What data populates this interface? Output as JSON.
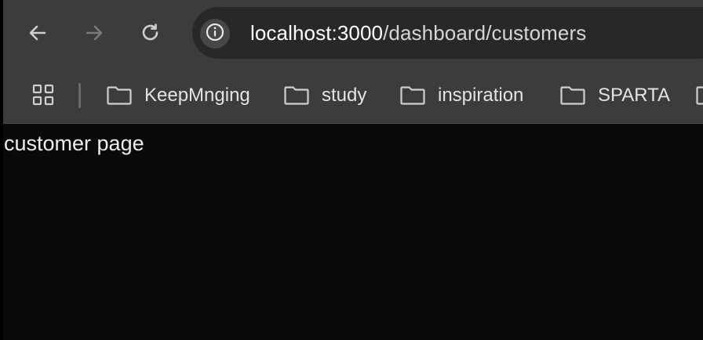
{
  "browser": {
    "nav": {
      "back_icon": "arrow-left-icon",
      "forward_icon": "arrow-right-icon",
      "reload_icon": "reload-icon",
      "forward_enabled": false
    },
    "omnibox": {
      "site_info_icon": "info-icon",
      "url_host": "localhost:3000",
      "url_path": "/dashboard/customers"
    },
    "bookmarks": {
      "apps_icon": "apps-grid-icon",
      "items": [
        {
          "label": "KeepMnging",
          "icon": "folder-icon"
        },
        {
          "label": "study",
          "icon": "folder-icon"
        },
        {
          "label": "inspiration",
          "icon": "folder-icon"
        },
        {
          "label": "SPARTA",
          "icon": "folder-icon"
        },
        {
          "label": "",
          "icon": "folder-icon"
        }
      ]
    }
  },
  "page": {
    "text": "customer page"
  },
  "colors": {
    "toolbar_bg": "#3c3c3c",
    "omnibox_bg": "#282828",
    "page_bg": "#0a0a0a",
    "text": "#ededed"
  }
}
